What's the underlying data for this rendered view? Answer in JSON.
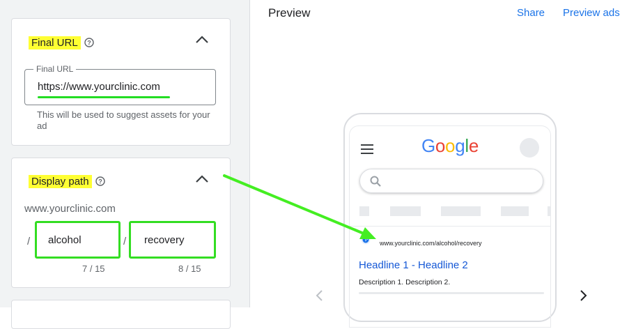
{
  "final_url_card": {
    "title": "Final URL",
    "field_label": "Final URL",
    "field_value": "https://www.yourclinic.com",
    "hint": "This will be used to suggest assets for your ad"
  },
  "display_path_card": {
    "title": "Display path",
    "domain": "www.yourclinic.com",
    "separator": "/",
    "path1": {
      "value": "alcohol",
      "counter": "7 / 15"
    },
    "path2": {
      "value": "recovery",
      "counter": "8 / 15"
    }
  },
  "preview": {
    "title": "Preview",
    "share_label": "Share",
    "preview_ads_label": "Preview ads"
  },
  "phone": {
    "logo_letters": [
      "G",
      "o",
      "o",
      "g",
      "l",
      "e"
    ],
    "logo_colors": [
      "#4285F4",
      "#EA4335",
      "#FBBC05",
      "#4285F4",
      "#34A853",
      "#EA4335"
    ],
    "ad_url": "www.yourclinic.com/alcohol/recovery",
    "headline": "Headline 1 - Headline 2",
    "description": "Description 1. Description 2."
  },
  "icons": {
    "help": "help-circle-icon",
    "collapse": "chevron-up-icon",
    "menu": "hamburger-menu-icon",
    "search": "search-icon",
    "globe": "globe-icon",
    "prev": "chevron-left-icon",
    "next": "chevron-right-icon"
  },
  "colors": {
    "highlight": "#ffff33",
    "annotation_green": "#33dd22",
    "link_blue": "#1a73e8"
  }
}
